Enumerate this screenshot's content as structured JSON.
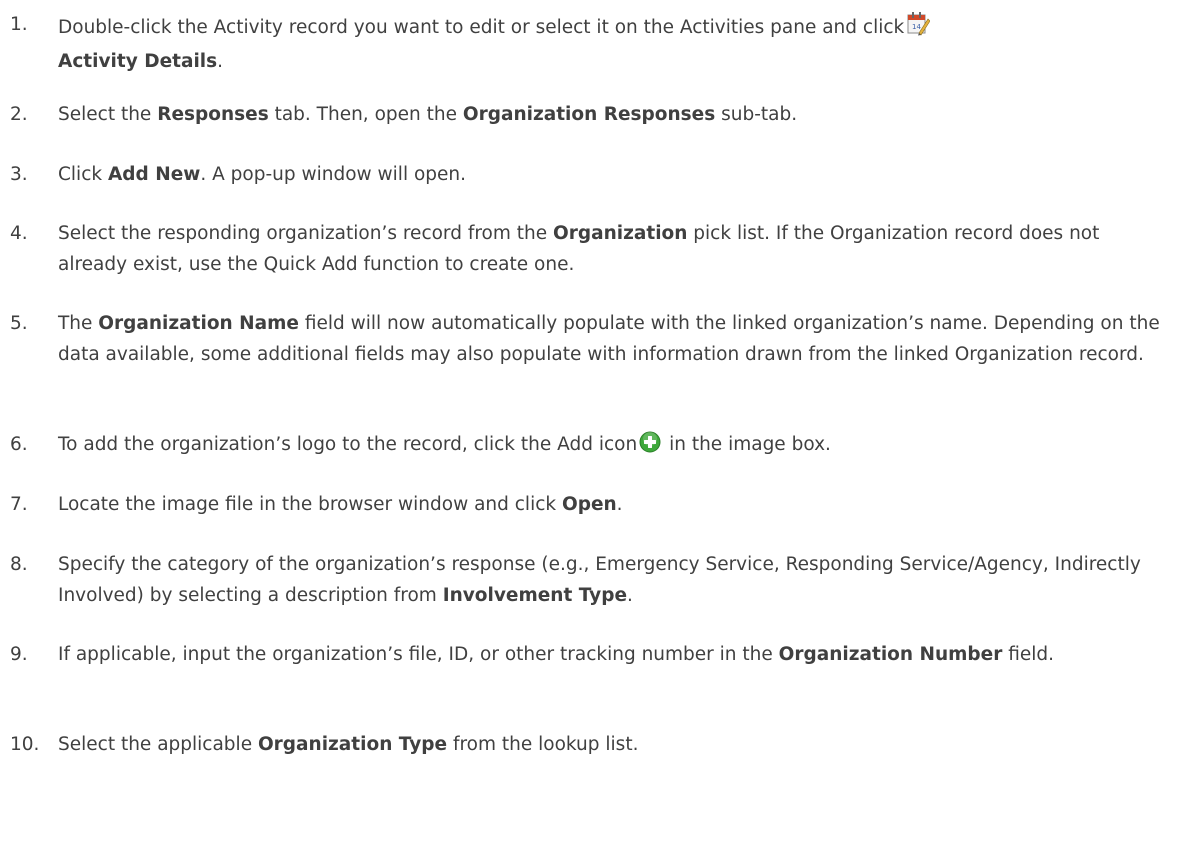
{
  "steps": [
    {
      "num": "1.",
      "parts": {
        "t1": "Double-click the Activity record you want to edit or select it on the Activities pane and click",
        "b1": "Activity Details",
        "t2": "."
      },
      "icon": "activity-details-calendar-icon"
    },
    {
      "num": "2.",
      "parts": {
        "t1": "Select the ",
        "b1": "Responses",
        "t2": " tab. Then, open the ",
        "b2": "Organization Responses",
        "t3": " sub-tab."
      }
    },
    {
      "num": "3.",
      "parts": {
        "t1": "Click ",
        "b1": "Add New",
        "t2": ". A pop-up window will open."
      }
    },
    {
      "num": "4.",
      "parts": {
        "t1": "Select the responding organization’s record from the ",
        "b1": "Organization",
        "t2": " pick list. If the Organization record does not already exist, use the Quick Add function to create one."
      }
    },
    {
      "num": "5.",
      "parts": {
        "t1": "The ",
        "b1": "Organization Name",
        "t2": " field will now automatically populate with the linked organization’s name. Depending on the data available, some additional fields may also populate with information drawn from the linked Organization record."
      }
    },
    {
      "num": "6.",
      "parts": {
        "t1": "To add the organization’s logo to the record, click the Add icon",
        "t2": " in the image box."
      },
      "icon": "add-plus-icon"
    },
    {
      "num": "7.",
      "parts": {
        "t1": "Locate the image file in the browser window and click ",
        "b1": "Open",
        "t2": "."
      }
    },
    {
      "num": "8.",
      "parts": {
        "t1": "Specify the category of the organization’s response (e.g., Emergency Service, Responding Service/Agency, Indirectly Involved) by selecting a description from ",
        "b1": "Involvement Type",
        "t2": "."
      }
    },
    {
      "num": "9.",
      "parts": {
        "t1": "If applicable, input the organization’s file, ID, or other tracking number in the ",
        "b1": "Organization Number",
        "t2": " field."
      }
    },
    {
      "num": "10.",
      "parts": {
        "t1": "Select the applicable ",
        "b1": "Organization Type",
        "t2": " from the lookup list."
      }
    }
  ],
  "colors": {
    "text": "#404040",
    "add_icon_green": "#3ea83a"
  }
}
